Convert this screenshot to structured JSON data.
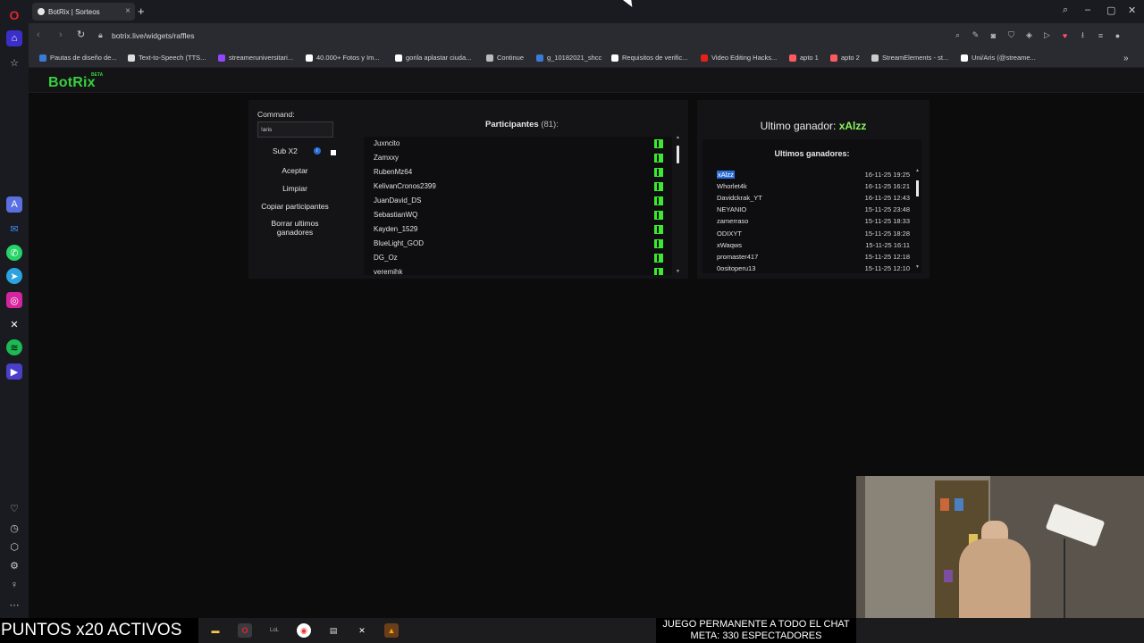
{
  "browser": {
    "tab_title": "BotRix | Sorteos",
    "url": "botrix.live/widgets/raffles"
  },
  "bookmarks": [
    {
      "label": "Pautas de diseño de...",
      "color": "#3a7bd5"
    },
    {
      "label": "Text-to-Speech (TTS...",
      "color": "#dddddd"
    },
    {
      "label": "streameruniversitari...",
      "color": "#9146ff"
    },
    {
      "label": "40.000+ Fotos y Im...",
      "color": "#ffffff"
    },
    {
      "label": "gorila aplastar ciuda...",
      "color": "#ffffff"
    },
    {
      "label": "Continue",
      "color": "#bbbbbb"
    },
    {
      "label": "g_10182021_shcc",
      "color": "#3a7bd5"
    },
    {
      "label": "Requisitos de verific...",
      "color": "#ffffff"
    },
    {
      "label": "Video Editing Hacks...",
      "color": "#e62117"
    },
    {
      "label": "apto 1",
      "color": "#ff5a5f"
    },
    {
      "label": "apto 2",
      "color": "#ff5a5f"
    },
    {
      "label": "StreamElements - st...",
      "color": "#cccccc"
    },
    {
      "label": "Uni/Aris (@streame...",
      "color": "#ffffff"
    }
  ],
  "app": {
    "logo": "BotRix",
    "beta": "BETA"
  },
  "controls": {
    "command_label": "Command:",
    "command_value": "!aris",
    "sub_label": "Sub X2",
    "accept": "Aceptar",
    "clear": "Limpiar",
    "copy": "Copiar participantes",
    "delete": "Borrar ultimos ganadores"
  },
  "participants": {
    "title": "Participantes",
    "count": "(81):",
    "list": [
      "Juxncito",
      "Zamxxy",
      "RubenMz64",
      "KelivanCronos2399",
      "JuanDavid_DS",
      "SebastianWQ",
      "Kayden_1529",
      "BlueLight_GOD",
      "DG_Oz",
      "veremihk"
    ]
  },
  "winners": {
    "last_label": "Ultimo ganador:",
    "last_name": "xAlzz",
    "title": "Ultimos ganadores:",
    "list": [
      {
        "name": "xAlzz",
        "date": "16-11-25 19:25"
      },
      {
        "name": "Whorlet4k",
        "date": "16-11-25 16:21"
      },
      {
        "name": "Davidckrak_YT",
        "date": "16-11-25 12:43"
      },
      {
        "name": "NEYANIO",
        "date": "15-11-25 23:48"
      },
      {
        "name": "zamerraso",
        "date": "15-11-25 18:33"
      },
      {
        "name": "ODIXYT",
        "date": "15-11-25 18:28"
      },
      {
        "name": "xWaqws",
        "date": "15-11-25 16:11"
      },
      {
        "name": "promaster417",
        "date": "15-11-25 12:18"
      },
      {
        "name": "0ositoperu13",
        "date": "15-11-25 12:10"
      }
    ]
  },
  "overlay": {
    "left_ticker": "PUNTOS x20 ACTIVOS",
    "right_line1": "JUEGO PERMANENTE A TODO EL CHAT",
    "right_line2": "META: 330 ESPECTADORES"
  }
}
